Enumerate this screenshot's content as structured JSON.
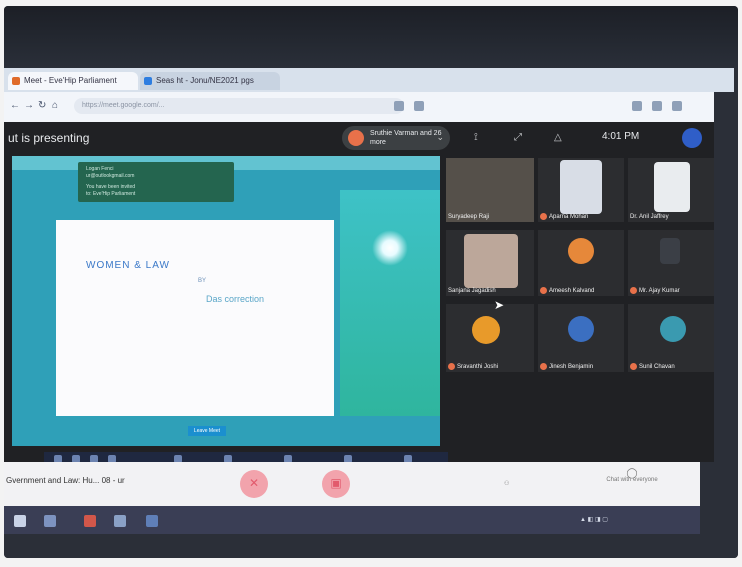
{
  "browser": {
    "tabs": [
      {
        "label": "Meet - Eve'Hip Parliament"
      },
      {
        "label": "Seas ht - Jonu/NE2021 pgs"
      }
    ],
    "address_placeholder": "https://meet.google.com/..."
  },
  "meet": {
    "presenting_label": "ut is presenting",
    "presenter_badge": "Sruthie Varman and 26 more",
    "time": "4:01 PM",
    "meeting_title": "Gvernment and Law: Hu... 08 - ur",
    "chat_label": "Chat with everyone",
    "participants": [
      {
        "name": "Suryadeep Raji"
      },
      {
        "name": "Aparna Mohan"
      },
      {
        "name": "Dr. Anil Jaffrey"
      },
      {
        "name": "Sanjana Jagadish"
      },
      {
        "name": "Ameesh Kalvand"
      },
      {
        "name": "Mr. Ajay Kumar"
      },
      {
        "name": "Sravanthi Joshi"
      },
      {
        "name": "Jinesh Benjamin"
      },
      {
        "name": "Sunil Chavan"
      }
    ]
  },
  "shared_screen": {
    "notif_lines": [
      "Logan Fenci",
      "ur@outlookgmail.com",
      "You have been invited",
      "to: Eve'Hip Parliament"
    ],
    "slide_title": "WOMEN & LAW",
    "slide_sub1": "BY",
    "slide_sub2": "Das correction",
    "footer_button": "Leave Meet"
  },
  "colors": {
    "meet_bg": "#202124",
    "slide_bg": "#fbfbfd",
    "accent_teal": "#2fa0b8",
    "hangup_red": "#e25a6c"
  }
}
